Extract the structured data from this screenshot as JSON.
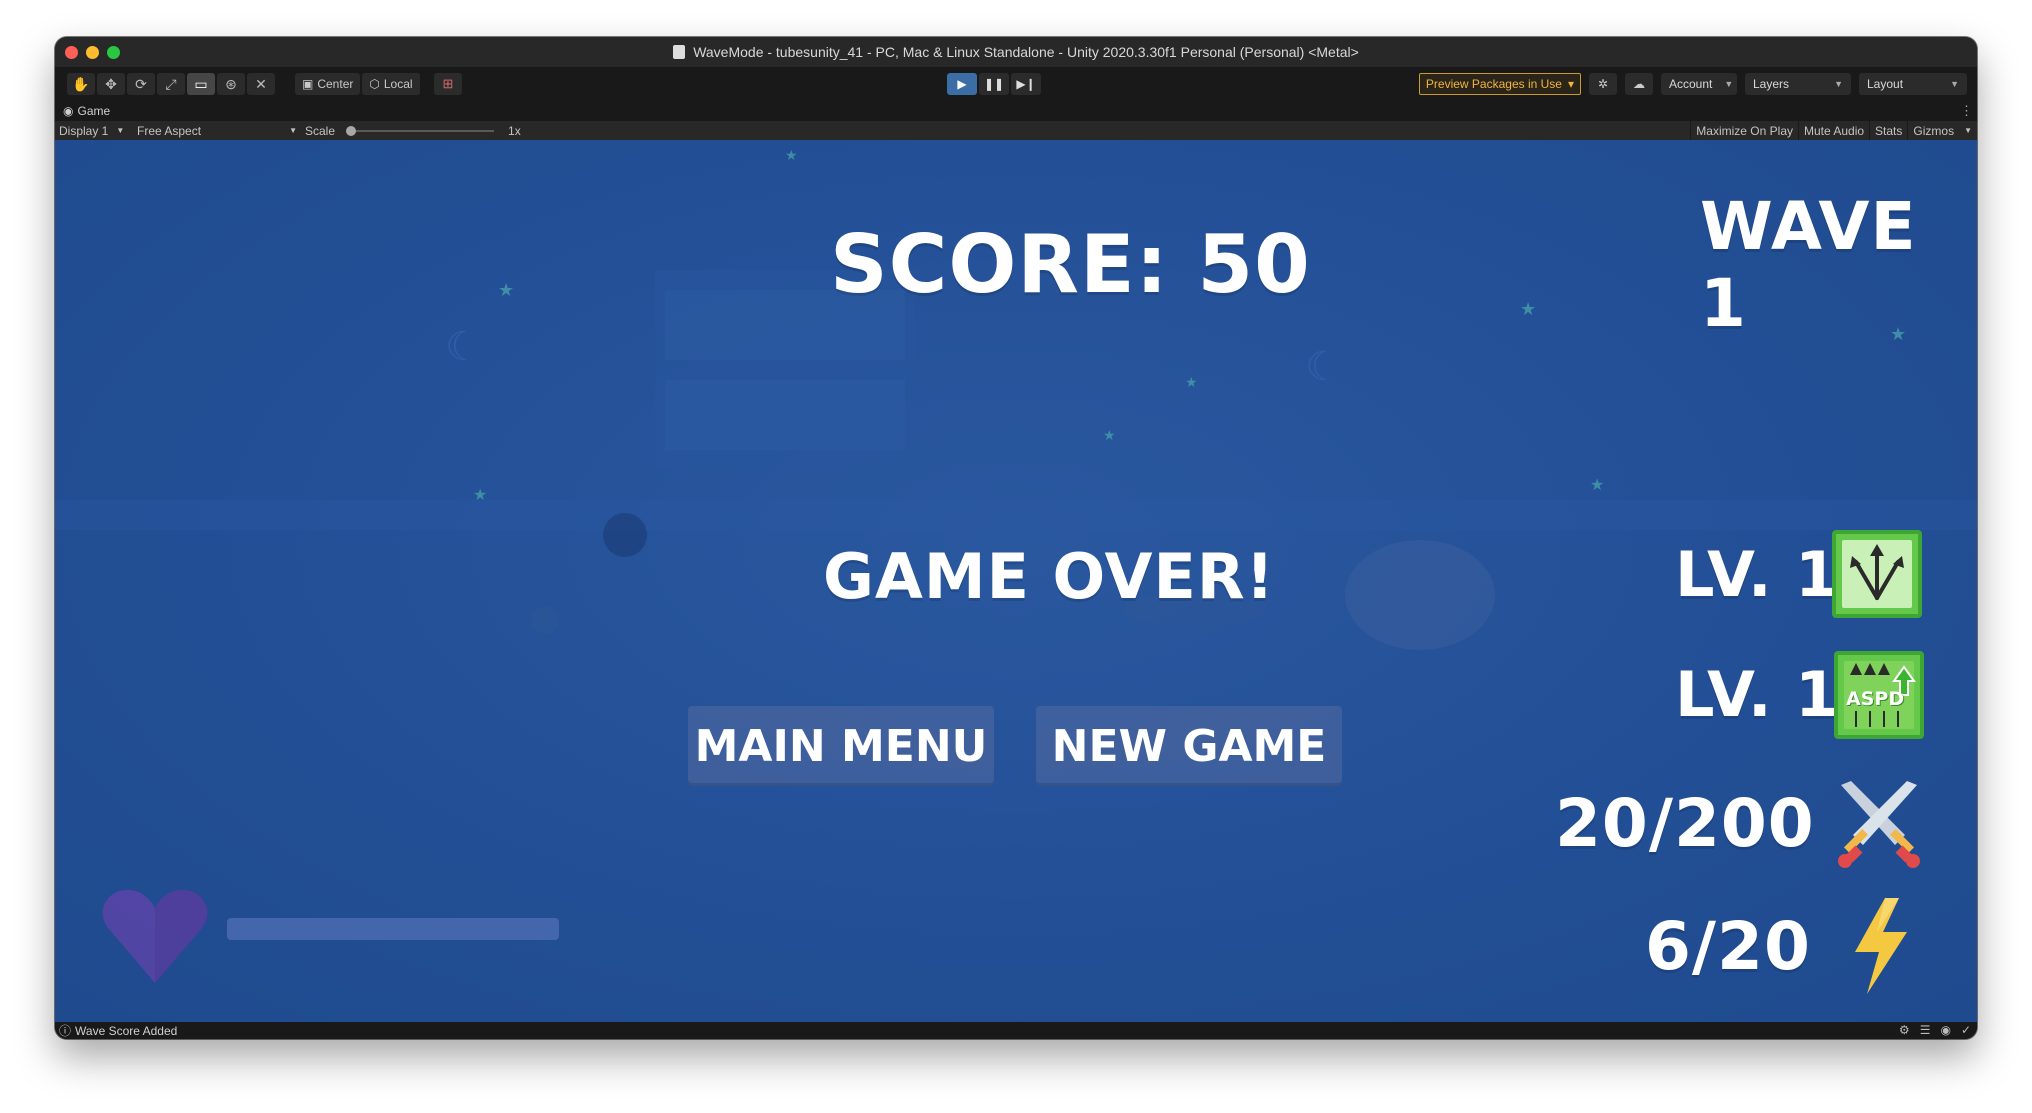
{
  "window": {
    "title": "WaveMode - tubesunity_41 - PC, Mac & Linux Standalone - Unity 2020.3.30f1 Personal (Personal) <Metal>"
  },
  "toolbar": {
    "pivot_center": "Center",
    "pivot_local": "Local",
    "preview_packages": "Preview Packages in Use",
    "account": "Account",
    "layers": "Layers",
    "layout": "Layout"
  },
  "game_tab": {
    "label": "Game",
    "display": "Display 1",
    "aspect": "Free Aspect",
    "scale_label": "Scale",
    "scale_value": "1x",
    "scale_fraction": 0.0,
    "maximize": "Maximize On Play",
    "mute": "Mute Audio",
    "stats": "Stats",
    "gizmos": "Gizmos"
  },
  "game": {
    "score": "SCORE: 50",
    "wave": "WAVE 1",
    "game_over": "GAME OVER!",
    "main_menu": "MAIN MENU",
    "new_game": "NEW GAME",
    "upgrade_1_level": "LV. 1",
    "upgrade_2_level": "LV. 1",
    "upgrade_2_tag": "ASPD",
    "kills": "20/200",
    "energy": "6/20",
    "health_fraction": 1.0
  },
  "status": {
    "message": "Wave Score Added"
  },
  "colors": {
    "viewport_bg": "#234f96",
    "play_active": "#3b6ea5",
    "preview_warn": "#f0b53d",
    "upgrade_green": "#64c94a",
    "heart": "#5b44a8",
    "bolt": "#f5c842"
  }
}
